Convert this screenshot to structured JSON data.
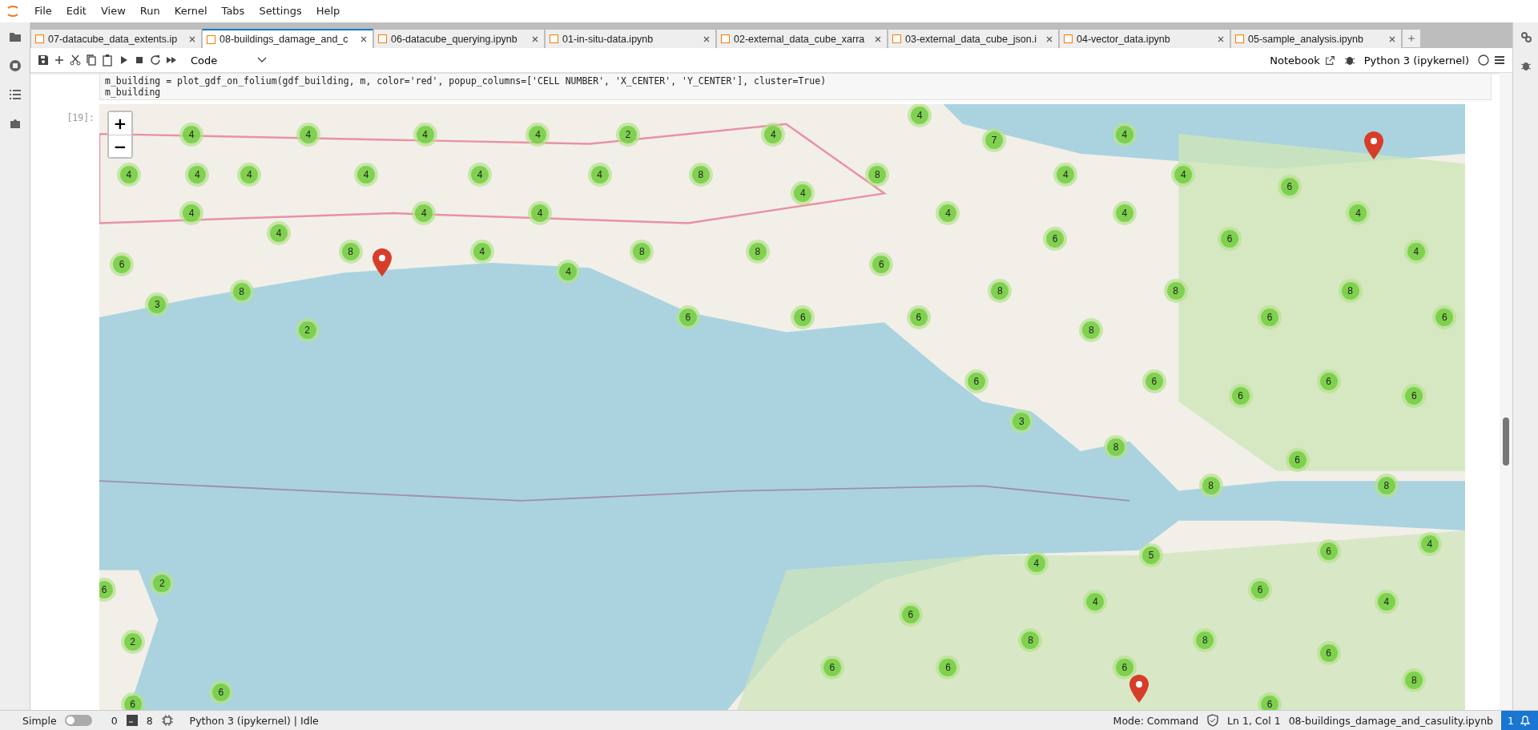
{
  "menu": [
    "File",
    "Edit",
    "View",
    "Run",
    "Kernel",
    "Tabs",
    "Settings",
    "Help"
  ],
  "tabs": [
    {
      "label": "07-datacube_data_extents.ip",
      "selected": false
    },
    {
      "label": "08-buildings_damage_and_c",
      "selected": true
    },
    {
      "label": "06-datacube_querying.ipynb",
      "selected": false
    },
    {
      "label": "01-in-situ-data.ipynb",
      "selected": false
    },
    {
      "label": "02-external_data_cube_xarra",
      "selected": false
    },
    {
      "label": "03-external_data_cube_json.i",
      "selected": false
    },
    {
      "label": "04-vector_data.ipynb",
      "selected": false
    },
    {
      "label": "05-sample_analysis.ipynb",
      "selected": false
    }
  ],
  "toolbar": {
    "cell_type": "Code",
    "notebook_label": "Notebook",
    "kernel": "Python 3 (ipykernel)"
  },
  "cell": {
    "code": [
      "m_building = plot_gdf_on_folium(gdf_building, m, color='red', popup_columns=['CELL NUMBER', 'X_CENTER', 'Y_CENTER'], cluster=True)",
      "m_building"
    ],
    "output_prompt": "[19]:"
  },
  "map": {
    "zoom_in": "+",
    "zoom_out": "−",
    "clusters": [
      {
        "count": "4"
      },
      {
        "count": "4"
      },
      {
        "count": "4"
      },
      {
        "count": "4"
      },
      {
        "count": "2"
      },
      {
        "count": "4"
      },
      {
        "count": "4"
      },
      {
        "count": "7"
      },
      {
        "count": "4"
      },
      {
        "count": "4"
      },
      {
        "count": "4"
      },
      {
        "count": "4"
      },
      {
        "count": "4"
      },
      {
        "count": "4"
      },
      {
        "count": "4"
      },
      {
        "count": "8"
      },
      {
        "count": "8"
      },
      {
        "count": "4"
      },
      {
        "count": "4"
      },
      {
        "count": "6"
      },
      {
        "count": "4"
      },
      {
        "count": "4"
      },
      {
        "count": "4"
      },
      {
        "count": "4"
      },
      {
        "count": "4"
      },
      {
        "count": "4"
      },
      {
        "count": "4"
      },
      {
        "count": "4"
      },
      {
        "count": "6"
      },
      {
        "count": "8"
      },
      {
        "count": "4"
      },
      {
        "count": "4"
      },
      {
        "count": "8"
      },
      {
        "count": "8"
      },
      {
        "count": "6"
      },
      {
        "count": "6"
      },
      {
        "count": "6"
      },
      {
        "count": "4"
      },
      {
        "count": "8"
      },
      {
        "count": "3"
      },
      {
        "count": "2"
      },
      {
        "count": "6"
      },
      {
        "count": "6"
      },
      {
        "count": "6"
      },
      {
        "count": "8"
      },
      {
        "count": "8"
      },
      {
        "count": "8"
      },
      {
        "count": "8"
      },
      {
        "count": "6"
      },
      {
        "count": "6"
      },
      {
        "count": "6"
      },
      {
        "count": "6"
      },
      {
        "count": "6"
      },
      {
        "count": "6"
      },
      {
        "count": "6"
      },
      {
        "count": "3"
      },
      {
        "count": "8"
      },
      {
        "count": "6"
      },
      {
        "count": "8"
      },
      {
        "count": "8"
      },
      {
        "count": "4"
      },
      {
        "count": "5"
      },
      {
        "count": "6"
      },
      {
        "count": "4"
      },
      {
        "count": "6"
      },
      {
        "count": "2"
      },
      {
        "count": "4"
      },
      {
        "count": "6"
      },
      {
        "count": "4"
      },
      {
        "count": "6"
      },
      {
        "count": "2"
      },
      {
        "count": "8"
      },
      {
        "count": "8"
      },
      {
        "count": "6"
      },
      {
        "count": "6"
      },
      {
        "count": "6"
      },
      {
        "count": "6"
      },
      {
        "count": "8"
      },
      {
        "count": "6"
      },
      {
        "count": "6"
      },
      {
        "count": "6"
      }
    ]
  },
  "status_bar": {
    "mode_label": "Simple",
    "simple_on": false,
    "terminals": "0",
    "kernels": "8",
    "kernel_status": "Python 3 (ipykernel) | Idle",
    "mode": "Mode: Command",
    "cursor": "Ln 1, Col 1",
    "file": "08-buildings_damage_and_casulity.ipynb",
    "notifications": "1"
  }
}
